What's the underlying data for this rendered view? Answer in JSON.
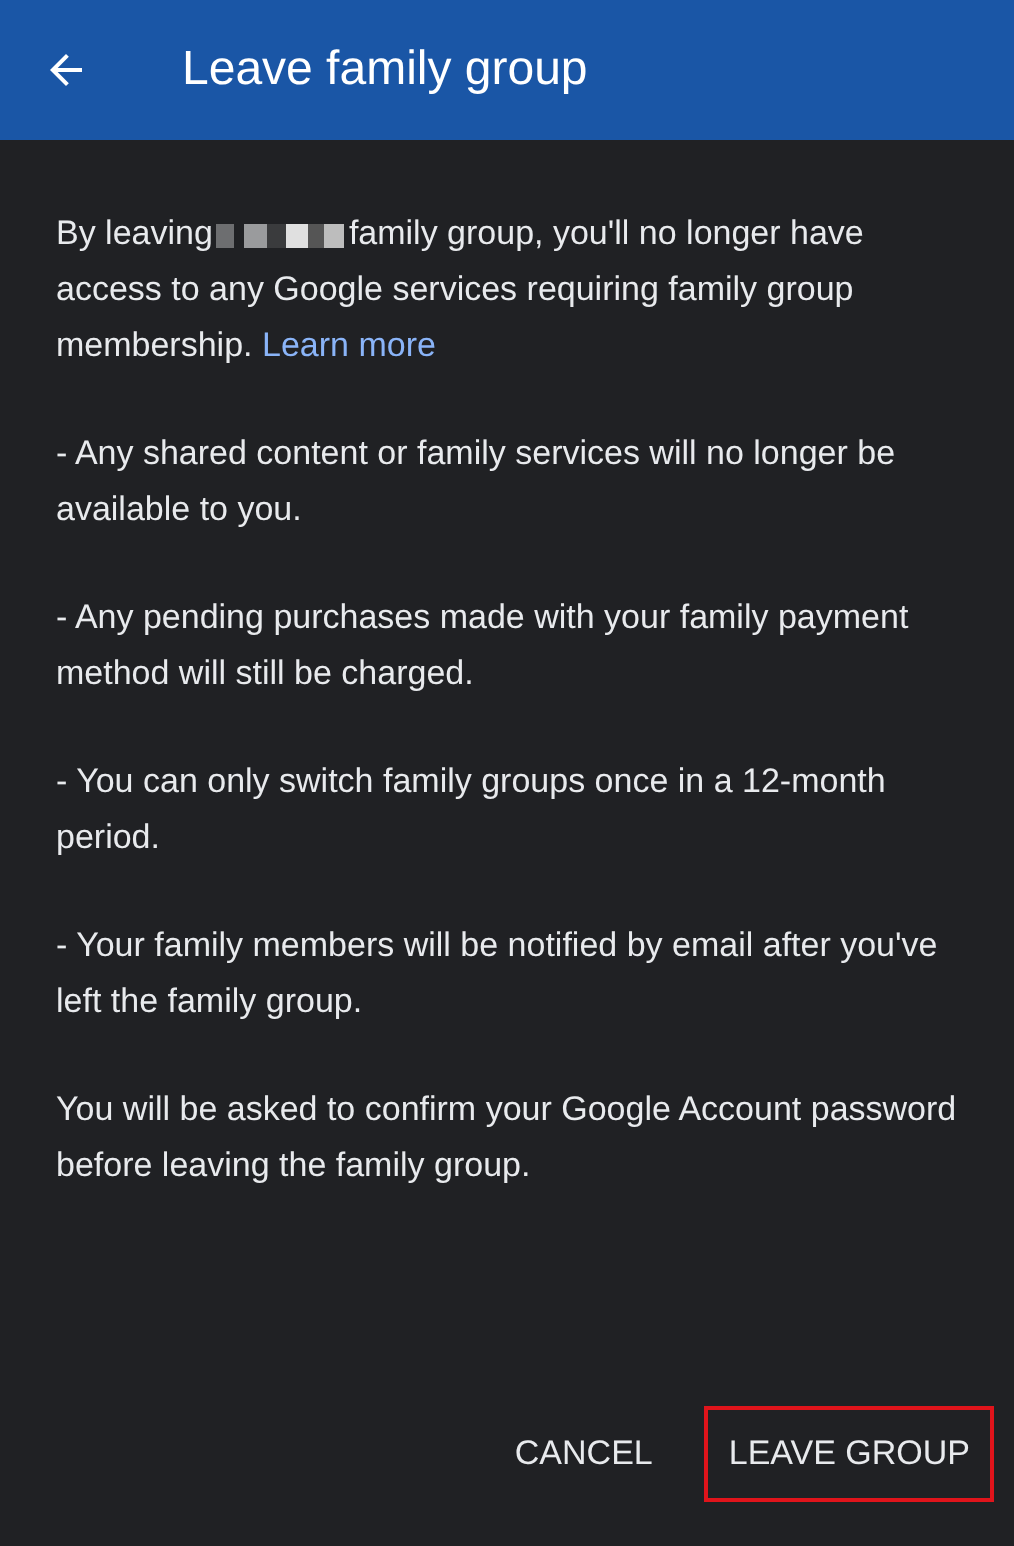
{
  "header": {
    "title": "Leave family group"
  },
  "intro": {
    "before": "By leaving",
    "after": "family group, you'll no longer have access to any Google services requiring family group membership.",
    "link": "Learn more"
  },
  "points": [
    "- Any shared content or family services will no longer be available to you.",
    "- Any pending purchases made with your family payment method will still be charged.",
    "- You can only switch family groups once in a 12-month period.",
    "- Your family members will be notified by email after you've left the family group."
  ],
  "note": "You will be asked to confirm your Google Account password before leaving the family group.",
  "buttons": [
    {
      "label": "CANCEL",
      "highlighted": false
    },
    {
      "label": "LEAVE GROUP",
      "highlighted": true
    }
  ]
}
